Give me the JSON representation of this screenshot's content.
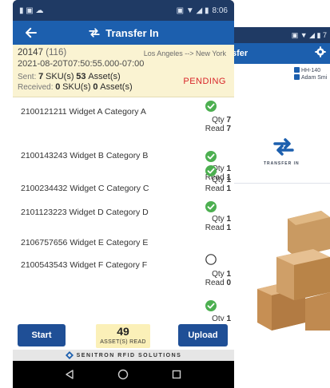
{
  "background_screen": {
    "status_right": "▣ ▼ ◢ ▮ 7",
    "title_fragment": "sfer",
    "device": "HH-140",
    "user": "Adam Smi",
    "transfer_in_label": "TRANSFER IN"
  },
  "status_bar": {
    "left_glyphs": "▮ ▣ ☁",
    "right_glyphs": "▣ ▼ ◢ ▮",
    "time": "8:06"
  },
  "app_bar": {
    "title": "Transfer In"
  },
  "transfer": {
    "id": "20147",
    "count": "(116)",
    "route": "Los Angeles --> New York",
    "datetime": "2021-08-20T07:50:55.000-07:00",
    "sent_label": "Sent:",
    "sent_sku": "7",
    "sent_sku_unit": "SKU(s)",
    "sent_assets": "53",
    "sent_assets_unit": "Asset(s)",
    "received_label": "Received:",
    "received_sku": "0",
    "received_sku_unit": "SKU(s)",
    "received_assets": "0",
    "received_assets_unit": "Asset(s)",
    "status": "PENDING"
  },
  "items": [
    {
      "text": "2100121211  Widget A  Category A",
      "checked": true,
      "qty": "7",
      "read": "7"
    },
    {
      "text": "2100143243  Widget B  Category B",
      "checked": true,
      "qty": "1",
      "read": "1"
    },
    {
      "text": "2100234432  Widget C  Category C",
      "checked": true,
      "qty": "1",
      "read": "1"
    },
    {
      "text": "2101123223  Widget D  Category D",
      "checked": true,
      "qty": "1",
      "read": "1"
    },
    {
      "text": "2106757656  Widget E  Category E",
      "checked": false,
      "qty": "1",
      "read": "0"
    },
    {
      "text": "2100543543  Widget F  Category F",
      "checked": true,
      "qty": "1",
      "read": ""
    }
  ],
  "labels": {
    "qty": "Qty",
    "read": "Read"
  },
  "bottom": {
    "start_label": "Start",
    "upload_label": "Upload",
    "assets_read_count": "49",
    "assets_read_label": "ASSET(S) READ"
  },
  "brand": {
    "name": "SENITRON RFID SOLUTIONS"
  },
  "colors": {
    "status_bar": "#1f3a64",
    "app_bar": "#1c5fae",
    "info_panel": "#faf3d2",
    "pending": "#d8262a",
    "check_green": "#4caf50",
    "button": "#1f4f96",
    "badge": "#fbf0b8"
  },
  "icons": {
    "back": "arrow-left-icon",
    "transfer": "swap-arrows-icon",
    "check": "check-circle-icon",
    "empty": "empty-circle-icon",
    "gear": "gear-icon",
    "nav_back": "triangle-back-icon",
    "nav_home": "circle-home-icon",
    "nav_recent": "square-recent-icon"
  }
}
